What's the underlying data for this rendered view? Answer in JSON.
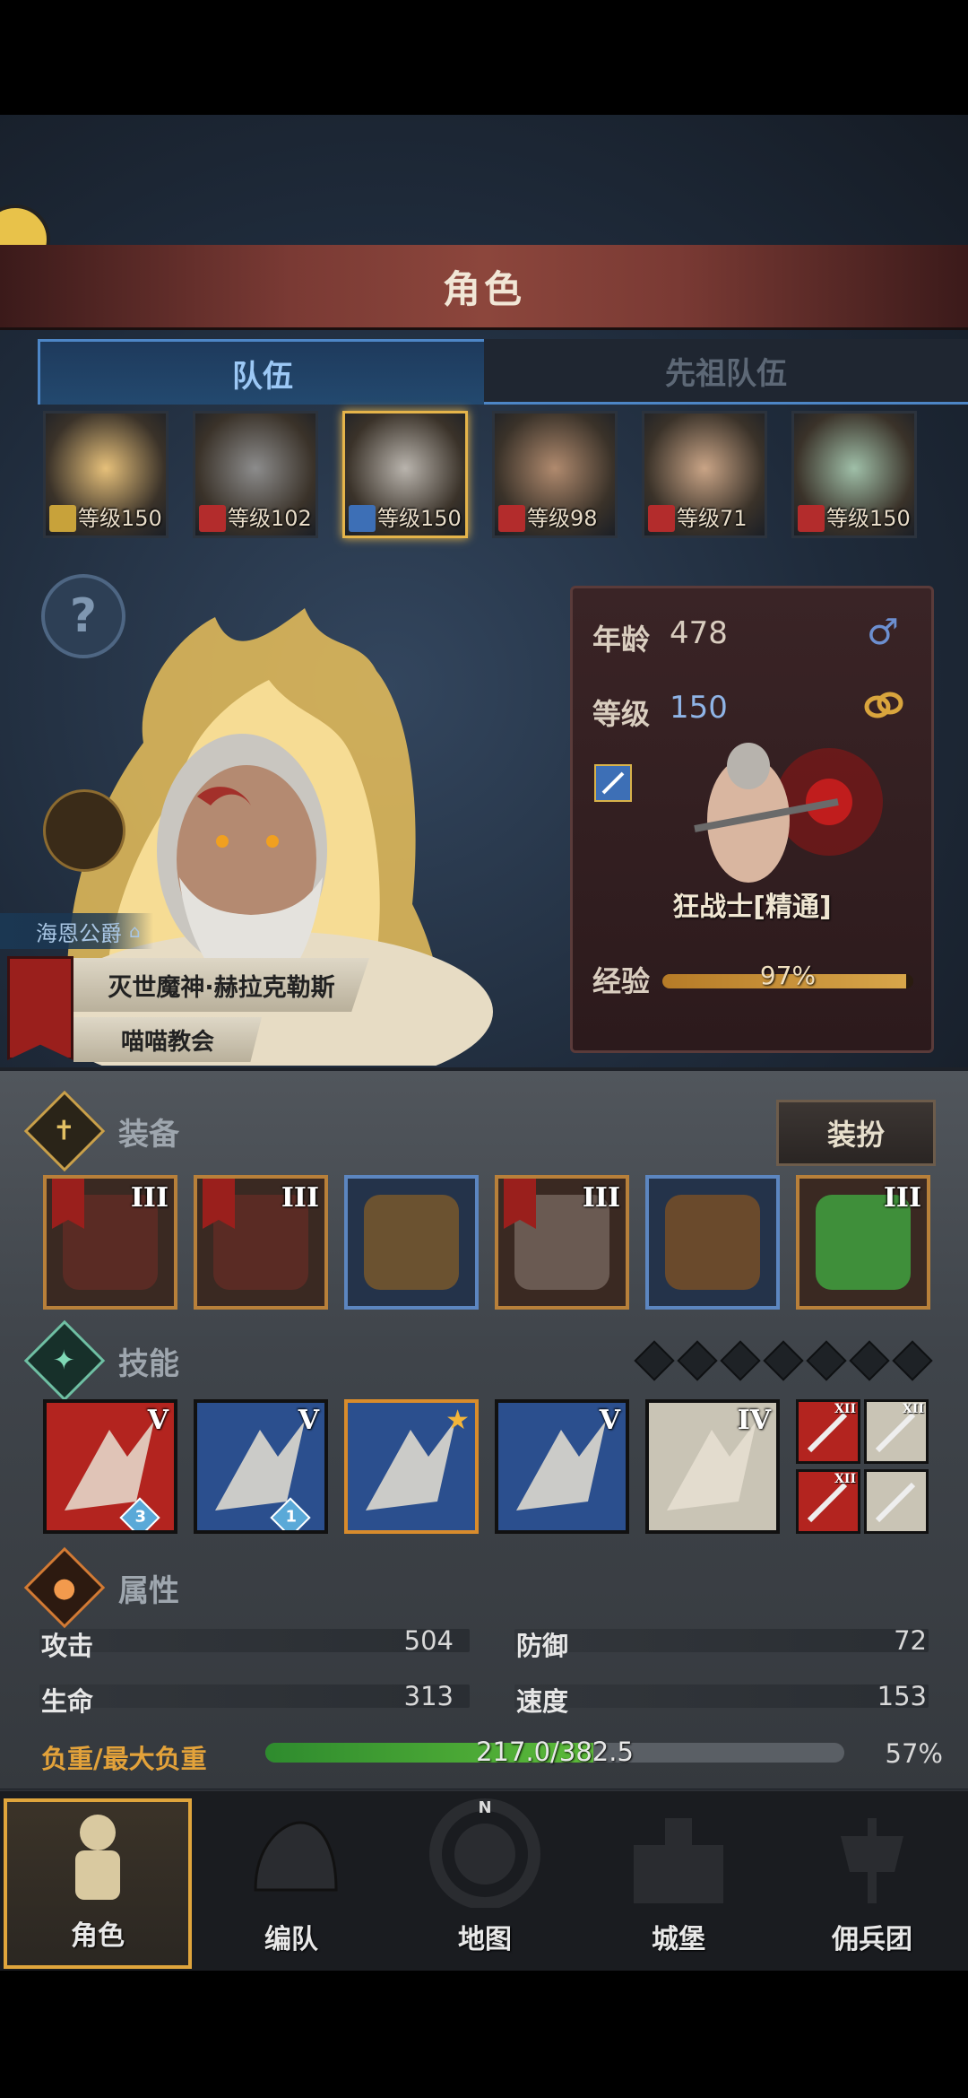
{
  "header": {
    "title": "角色"
  },
  "tabs": [
    {
      "label": "队伍"
    },
    {
      "label": "先祖队伍"
    }
  ],
  "team": [
    {
      "level_text": "等级150",
      "class_icon": "bow-icon",
      "class_color": "#c8a23a",
      "selected": false
    },
    {
      "level_text": "等级102",
      "class_icon": "beast-icon",
      "class_color": "#b32c2c",
      "selected": false
    },
    {
      "level_text": "等级150",
      "class_icon": "sword-icon",
      "class_color": "#3d6fb6",
      "selected": true
    },
    {
      "level_text": "等级98",
      "class_icon": "beast-icon",
      "class_color": "#b32c2c",
      "selected": false
    },
    {
      "level_text": "等级71",
      "class_icon": "beast-icon",
      "class_color": "#b32c2c",
      "selected": false
    },
    {
      "level_text": "等级150",
      "class_icon": "beast-icon",
      "class_color": "#b32c2c",
      "selected": false
    }
  ],
  "character": {
    "nobility": "海恩公爵",
    "title": "灭世魔神·赫拉克勒斯",
    "church": "喵喵教会",
    "age_label": "年龄",
    "age": "478",
    "gender_icon": "male-icon",
    "level_label": "等级",
    "level": "150",
    "ring_icon": "ring-icon",
    "class_name": "狂战士[精通]",
    "exp_label": "经验",
    "exp_percent_text": "97%",
    "exp_fraction": 0.97
  },
  "equipment": {
    "title": "装备",
    "dress_button": "装扮",
    "slots": [
      {
        "name": "weapon-axe",
        "rank": "III",
        "flag": true,
        "border": "orange"
      },
      {
        "name": "weapon-axe-offhand",
        "rank": "III",
        "flag": true,
        "border": "orange"
      },
      {
        "name": "helmet",
        "rank": "",
        "flag": false,
        "border": "blue"
      },
      {
        "name": "armor",
        "rank": "III",
        "flag": true,
        "border": "orange"
      },
      {
        "name": "boots",
        "rank": "",
        "flag": false,
        "border": "blue"
      },
      {
        "name": "jade-accessory",
        "rank": "III",
        "flag": false,
        "border": "orange"
      }
    ]
  },
  "skills": {
    "title": "技能",
    "items": [
      {
        "rank": "V",
        "badge": "3",
        "bg": "#b3241f"
      },
      {
        "rank": "V",
        "badge": "1",
        "bg": "#2b4f8e"
      },
      {
        "rank": "",
        "badge": "",
        "bg": "#2b4f8e",
        "star": true
      },
      {
        "rank": "V",
        "badge": "",
        "bg": "#2b4f8e"
      },
      {
        "rank": "IV",
        "badge": "",
        "bg": "#c9c4b5"
      }
    ],
    "passives": [
      {
        "rank": "XII",
        "bg": "#b3241f"
      },
      {
        "rank": "XII",
        "bg": "#c9c4b5"
      },
      {
        "rank": "XII",
        "bg": "#b3241f"
      },
      {
        "rank": "",
        "bg": "#c9c4b5"
      }
    ],
    "slot_count": 7
  },
  "attributes": {
    "title": "属性",
    "attack_label": "攻击",
    "attack": "504",
    "defense_label": "防御",
    "defense": "72",
    "hp_label": "生命",
    "hp": "313",
    "speed_label": "速度",
    "speed": "153",
    "load_label": "负重/最大负重",
    "load_text": "217.0/382.5",
    "load_percent": "57%",
    "load_fraction": 0.567
  },
  "nav": [
    {
      "label": "角色",
      "icon": "knight-icon",
      "active": true
    },
    {
      "label": "编队",
      "icon": "helmet-icon",
      "active": false
    },
    {
      "label": "地图",
      "icon": "compass-icon",
      "active": false,
      "compass_letter": "N"
    },
    {
      "label": "城堡",
      "icon": "castle-icon",
      "active": false
    },
    {
      "label": "佣兵团",
      "icon": "banner-icon",
      "active": false
    }
  ]
}
